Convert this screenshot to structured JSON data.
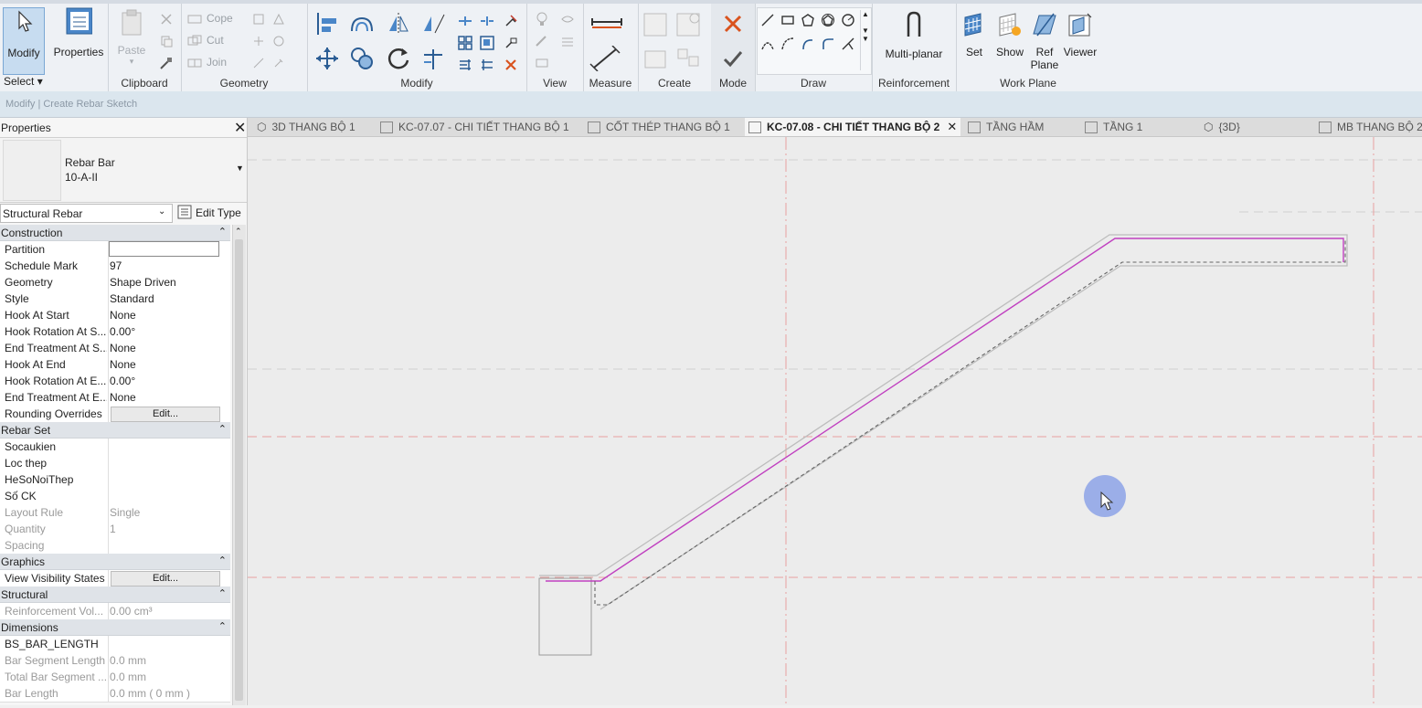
{
  "ribbon": {
    "modify_label": "Modify",
    "properties_label": "Properties",
    "select_label": "Select",
    "clipboard": {
      "label": "Clipboard",
      "paste": "Paste"
    },
    "geometry": {
      "label": "Geometry",
      "cope": "Cope",
      "cut": "Cut",
      "join": "Join"
    },
    "modify_panel": "Modify",
    "view": "View",
    "measure": "Measure",
    "create": "Create",
    "mode": "Mode",
    "draw": "Draw",
    "reinforcement": {
      "label": "Reinforcement",
      "multiplanar": "Multi-planar"
    },
    "workplane": {
      "label": "Work Plane",
      "set": "Set",
      "show": "Show",
      "ref": "Ref",
      "plane": "Plane",
      "viewer": "Viewer"
    }
  },
  "optionsbar": {
    "text": "Modify | Create Rebar Sketch"
  },
  "properties": {
    "title": "Properties",
    "type_name": "Rebar Bar",
    "type_sub": "10-A-II",
    "filter": "Structural Rebar",
    "edit_type": "Edit Type",
    "groups": {
      "construction": "Construction",
      "rebarset": "Rebar Set",
      "graphics": "Graphics",
      "structural": "Structural",
      "dimensions": "Dimensions"
    },
    "rows": {
      "partition": {
        "k": "Partition",
        "v": ""
      },
      "schedule_mark": {
        "k": "Schedule Mark",
        "v": "97"
      },
      "geometry": {
        "k": "Geometry",
        "v": "Shape Driven"
      },
      "style": {
        "k": "Style",
        "v": "Standard"
      },
      "hook_start": {
        "k": "Hook At Start",
        "v": "None"
      },
      "hook_rot_start": {
        "k": "Hook Rotation At S...",
        "v": "0.00°"
      },
      "end_treat_start": {
        "k": "End Treatment At S...",
        "v": "None"
      },
      "hook_end": {
        "k": "Hook At End",
        "v": "None"
      },
      "hook_rot_end": {
        "k": "Hook Rotation At E...",
        "v": "0.00°"
      },
      "end_treat_end": {
        "k": "End Treatment At E...",
        "v": "None"
      },
      "rounding": {
        "k": "Rounding Overrides",
        "v": "Edit..."
      },
      "socaukien": {
        "k": "Socaukien",
        "v": ""
      },
      "loc_thep": {
        "k": "Loc thep",
        "v": ""
      },
      "hesonoithep": {
        "k": "HeSoNoiThep",
        "v": ""
      },
      "so_ck": {
        "k": "Số CK",
        "v": ""
      },
      "layout_rule": {
        "k": "Layout Rule",
        "v": "Single"
      },
      "quantity": {
        "k": "Quantity",
        "v": "1"
      },
      "spacing": {
        "k": "Spacing",
        "v": ""
      },
      "visibility": {
        "k": "View Visibility States",
        "v": "Edit..."
      },
      "reinf_vol": {
        "k": "Reinforcement Vol...",
        "v": "0.00 cm³"
      },
      "bs_bar_length": {
        "k": "BS_BAR_LENGTH",
        "v": ""
      },
      "bar_seg_len": {
        "k": "Bar Segment Length",
        "v": "0.0 mm"
      },
      "total_bar_seg": {
        "k": "Total Bar Segment ...",
        "v": "0.0 mm"
      },
      "bar_length": {
        "k": "Bar Length",
        "v": "0.0 mm ( 0 mm )"
      }
    }
  },
  "tabs": [
    {
      "label": "3D THANG BỘ 1"
    },
    {
      "label": "KC-07.07 - CHI TIẾT THANG BỘ 1"
    },
    {
      "label": "CỐT THÉP THANG BỘ 1"
    },
    {
      "label": "KC-07.08 - CHI TIẾT THANG BỘ 2"
    },
    {
      "label": "TẦNG HẦM"
    },
    {
      "label": "TẦNG 1"
    },
    {
      "label": "{3D}"
    },
    {
      "label": "MB THANG BỘ 2"
    }
  ],
  "colors": {
    "rebar": "#c040c0",
    "ref_line": "#e8a0a0",
    "accent": "#3c7fc4"
  },
  "icons": [
    "cursor-icon",
    "properties-icon",
    "paste-icon",
    "close-x-icon",
    "checkmark-icon",
    "multiplanar-icon",
    "set-workplane-icon",
    "show-icon",
    "ref-plane-icon",
    "viewer-icon"
  ]
}
